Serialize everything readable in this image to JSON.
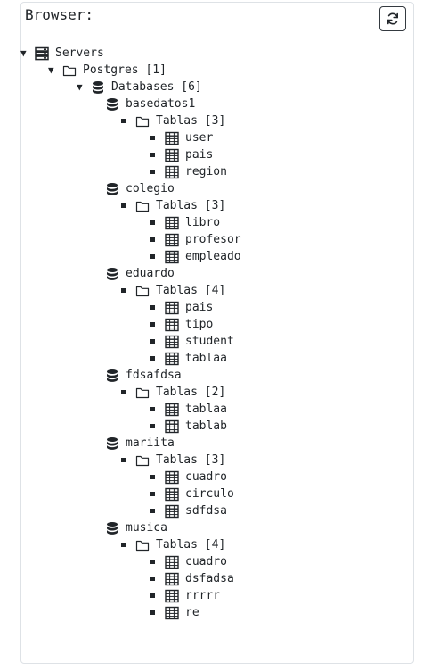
{
  "panel": {
    "title": "Browser:",
    "refresh_icon": "refresh-icon"
  },
  "tree": {
    "servers_label": "Servers",
    "server": {
      "label": "Postgres [1]"
    },
    "databases_label": "Databases [6]",
    "databases": [
      {
        "name": "basedatos1",
        "folder": "Tablas [3]",
        "tables": [
          "user",
          "pais",
          "region"
        ]
      },
      {
        "name": "colegio",
        "folder": "Tablas [3]",
        "tables": [
          "libro",
          "profesor",
          "empleado"
        ]
      },
      {
        "name": "eduardo",
        "folder": "Tablas [4]",
        "tables": [
          "pais",
          "tipo",
          "student",
          "tablaa"
        ]
      },
      {
        "name": "fdsafdsa",
        "folder": "Tablas [2]",
        "tables": [
          "tablaa",
          "tablab"
        ]
      },
      {
        "name": "mariita",
        "folder": "Tablas [3]",
        "tables": [
          "cuadro",
          "circulo",
          "sdfdsa"
        ]
      },
      {
        "name": "musica",
        "folder": "Tablas [4]",
        "tables": [
          "cuadro",
          "dsfadsa",
          "rrrrr",
          "re"
        ]
      }
    ]
  }
}
